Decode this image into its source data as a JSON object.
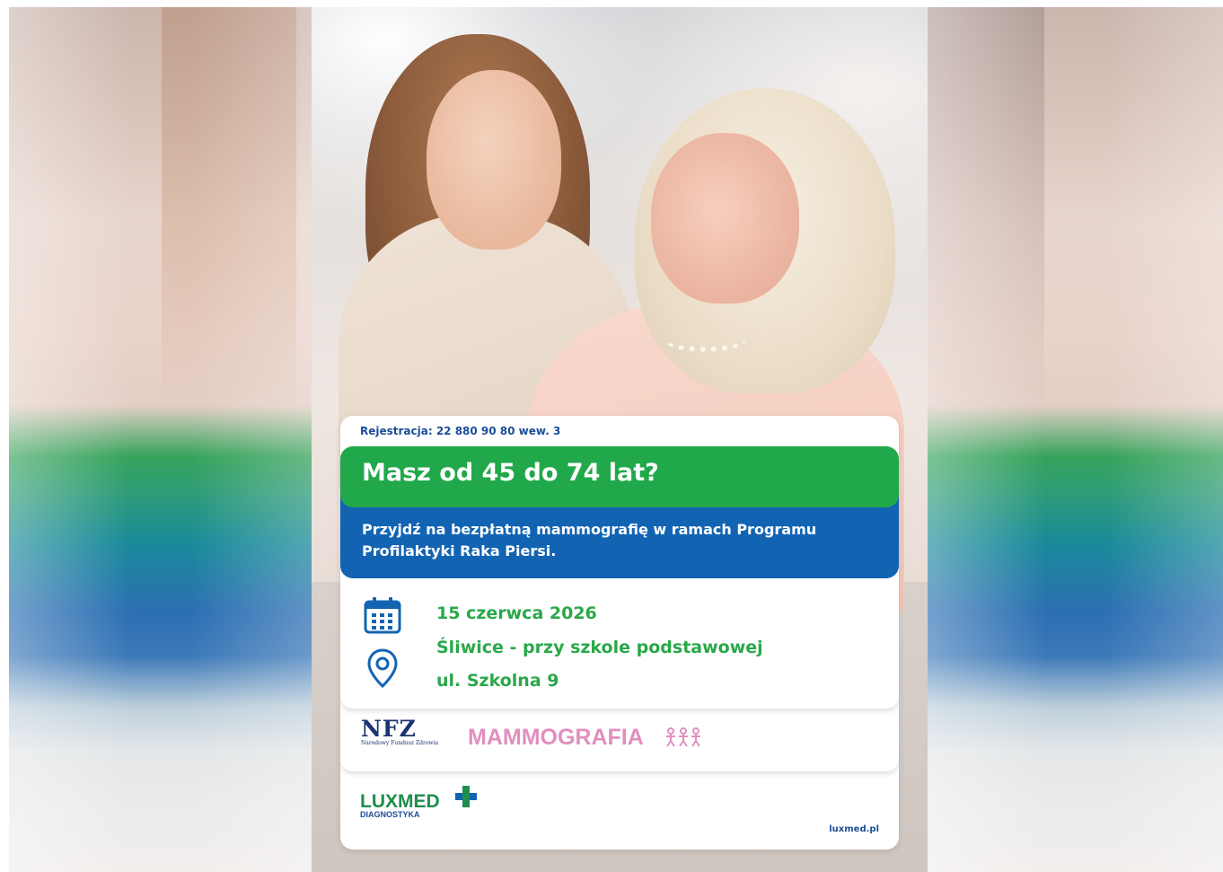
{
  "poster": {
    "registration": "Rejestracja: 22 880 90 80 wew. 3",
    "headline": "Masz od 45 do 74 lat?",
    "subline": "Przyjdź na bezpłatną mammografię w ramach Programu Profilaktyki Raka Piersi.",
    "date": "15 czerwca 2026",
    "place": "Śliwice - przy szkole podstawowej",
    "address": "ul. Szkolna 9",
    "website": "luxmed.pl"
  },
  "logos": {
    "nfz_mark": "NFZ",
    "nfz_text": "Narodowy Fundusz Zdrowia",
    "mammografia": "MAMMOGRAFIA",
    "luxmed": "LUXMED",
    "luxmed_sub": "DIAGNOSTYKA"
  },
  "icons": {
    "calendar": "calendar-icon",
    "location": "location-pin-icon"
  },
  "colors": {
    "green": "#21a84a",
    "blue": "#1264b3",
    "navy": "#1c4e98",
    "text_green": "#2aa84a",
    "pink": "#e18fbf"
  }
}
